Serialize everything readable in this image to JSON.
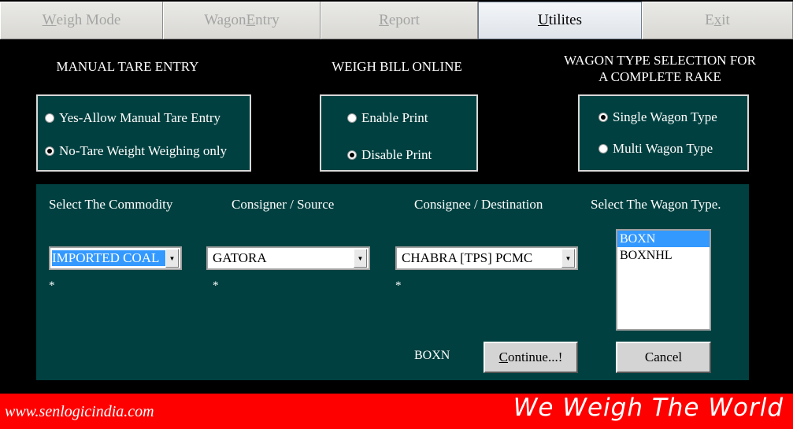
{
  "tabs": [
    {
      "pre": "",
      "u": "W",
      "post": "eigh Mode"
    },
    {
      "pre": "Wagon ",
      "u": "E",
      "post": "ntry"
    },
    {
      "pre": "",
      "u": "R",
      "post": "eport"
    },
    {
      "pre": "",
      "u": "U",
      "post": "tilites"
    },
    {
      "pre": "E",
      "u": "x",
      "post": "it"
    }
  ],
  "active_tab": "Utilites",
  "manual_tare": {
    "title": "MANUAL TARE ENTRY",
    "options": [
      "Yes-Allow Manual Tare Entry",
      "No-Tare Weight Weighing only"
    ],
    "selected": "No-Tare Weight Weighing only"
  },
  "weigh_bill": {
    "title": "WEIGH BILL ONLINE",
    "options": [
      "Enable Print",
      "Disable Print"
    ],
    "selected": "Disable Print"
  },
  "wagon_type_selection": {
    "title_line1": "WAGON TYPE SELECTION FOR",
    "title_line2": "A COMPLETE RAKE",
    "options": [
      "Single Wagon Type",
      "Multi Wagon Type"
    ],
    "selected": "Single Wagon Type"
  },
  "form": {
    "commodity_label": "Select The Commodity",
    "commodity_value": "IMPORTED COAL",
    "source_label": "Consigner / Source",
    "source_value": "GATORA",
    "destination_label": "Consignee / Destination",
    "destination_value": "CHABRA [TPS] PCMC",
    "wagon_type_label": "Select The Wagon Type.",
    "wagon_types": [
      "BOXN",
      "BOXNHL"
    ],
    "selected_wagon_type": "BOXN",
    "required_marker": "*",
    "current_wagon": "BOXN",
    "continue": {
      "u": "C",
      "post": "ontinue...!"
    },
    "cancel_label": "Cancel"
  },
  "footer": {
    "url": "www.senlogicindia.com",
    "slogan": "We Weigh The World"
  },
  "colors": {
    "panel": "#004040",
    "footer": "#ff0000",
    "selection": "#3399ff"
  }
}
